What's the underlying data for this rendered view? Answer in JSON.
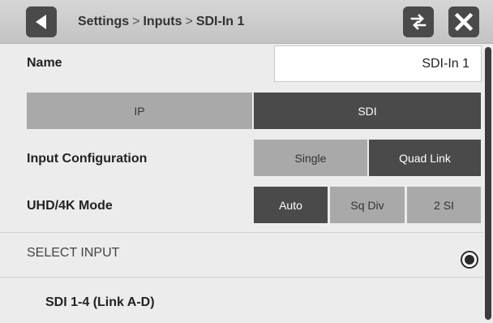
{
  "header": {
    "breadcrumb": [
      "Settings",
      "Inputs",
      "SDI-In 1"
    ],
    "separator": ">",
    "icons": {
      "back": "back-arrow-icon",
      "swap": "swap-arrows-icon",
      "close": "close-x-icon"
    }
  },
  "name_row": {
    "label": "Name",
    "value": "SDI-In 1"
  },
  "interface_toggle": {
    "options": [
      "IP",
      "SDI"
    ],
    "selected": "SDI"
  },
  "input_configuration": {
    "label": "Input Configuration",
    "options": [
      "Single",
      "Quad Link"
    ],
    "selected": "Quad Link"
  },
  "uhd_mode": {
    "label": "UHD/4K Mode",
    "options": [
      "Auto",
      "Sq Div",
      "2 SI"
    ],
    "selected": "Auto"
  },
  "select_input": {
    "heading": "SELECT INPUT",
    "items": [
      {
        "label": "SDI 1-4 (Link A-D)",
        "selected": true
      }
    ]
  },
  "colors": {
    "selected_bg": "#4a4a4a",
    "unselected_bg": "#a9a9a9",
    "page_bg": "#ececec",
    "header_bg": "#c9c9c9"
  }
}
